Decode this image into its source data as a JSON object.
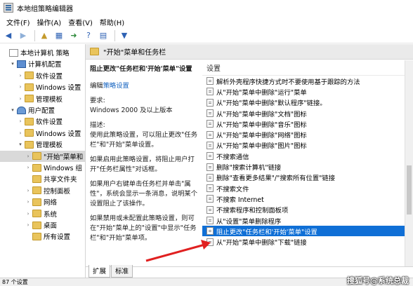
{
  "window": {
    "title": "本地组策略编辑器"
  },
  "menu": [
    "文件(F)",
    "操作(A)",
    "查看(V)",
    "帮助(H)"
  ],
  "tree": [
    {
      "label": "本地计算机 策略",
      "icon": "policy",
      "exp": "",
      "indent": 0
    },
    {
      "label": "计算机配置",
      "icon": "pc",
      "exp": "▾",
      "indent": 1
    },
    {
      "label": "软件设置",
      "icon": "folder",
      "exp": "›",
      "indent": 2
    },
    {
      "label": "Windows 设置",
      "icon": "folder",
      "exp": "›",
      "indent": 2
    },
    {
      "label": "管理模板",
      "icon": "folder",
      "exp": "›",
      "indent": 2
    },
    {
      "label": "用户配置",
      "icon": "user",
      "exp": "▾",
      "indent": 1
    },
    {
      "label": "软件设置",
      "icon": "folder",
      "exp": "›",
      "indent": 2
    },
    {
      "label": "Windows 设置",
      "icon": "folder",
      "exp": "›",
      "indent": 2
    },
    {
      "label": "管理模板",
      "icon": "folder",
      "exp": "▾",
      "indent": 2
    },
    {
      "label": "\"开始\"菜单和",
      "icon": "folder",
      "exp": "›",
      "indent": 3,
      "selected": true
    },
    {
      "label": "Windows 组",
      "icon": "folder",
      "exp": "›",
      "indent": 3
    },
    {
      "label": "共享文件夹",
      "icon": "folder",
      "exp": "",
      "indent": 3
    },
    {
      "label": "控制面板",
      "icon": "folder",
      "exp": "›",
      "indent": 3
    },
    {
      "label": "网络",
      "icon": "folder",
      "exp": "›",
      "indent": 3
    },
    {
      "label": "系统",
      "icon": "folder",
      "exp": "›",
      "indent": 3
    },
    {
      "label": "桌面",
      "icon": "folder",
      "exp": "›",
      "indent": 3
    },
    {
      "label": "所有设置",
      "icon": "folder",
      "exp": "",
      "indent": 3
    }
  ],
  "header": {
    "title": "\"开始\"菜单和任务栏"
  },
  "description": {
    "policy_title": "阻止更改\"任务栏和'开始'菜单\"设置",
    "edit_prefix": "编辑",
    "edit_link": "策略设置",
    "req_label": "要求:",
    "req_value": "Windows 2000 及以上版本",
    "desc_label": "描述:",
    "p1": "使用此策略设置，可以阻止更改\"任务栏\"和\"开始\"菜单设置。",
    "p2": "如果启用此策略设置，将阻止用户打开\"任务栏属性\"对话框。",
    "p3": "如果用户右键单击任务栏并单击\"属性\"，系统会显示一条消息，说明某个设置阻止了该操作。",
    "p4": "如果禁用或未配置此策略设置，则可在\"开始\"菜单上的\"设置\"中显示\"任务栏\"和\"开始\"菜单项。"
  },
  "settings": {
    "column_header": "设置",
    "items": [
      "解析外壳程序快捷方式时不要使用基于跟踪的方法",
      "从\"开始\"菜单中删除\"运行\"菜单",
      "从\"开始\"菜单中删除\"默认程序\"链接。",
      "从\"开始\"菜单中删除\"文档\"图标",
      "从\"开始\"菜单中删除\"音乐\"图标",
      "从\"开始\"菜单中删除\"网络\"图标",
      "从\"开始\"菜单中删除\"图片\"图标",
      "不搜索通信",
      "删除\"搜索计算机\"链接",
      "删除\"查看更多结果\"/\"搜索所有位置\"链接",
      "不搜索文件",
      "不搜索 Internet",
      "不搜索程序和控制面板项",
      "从\"设置\"菜单删除程序",
      "阻止更改\"任务栏和'开始'菜单\"设置",
      "从\"开始\"菜单中删除\"下载\"链接"
    ],
    "selected_index": 14
  },
  "tabs": [
    "扩展",
    "标准"
  ],
  "status": {
    "text": "87 个设置"
  },
  "watermark": "搜狐号@系统总裁",
  "colors": {
    "selection": "#0f6fd6",
    "arrow": "#e02020",
    "link": "#1463c0"
  },
  "icons": {
    "toolbar": [
      "back-arrow-icon",
      "forward-arrow-icon",
      "up-folder-icon",
      "show-tree-icon",
      "export-icon",
      "help-icon",
      "properties-icon",
      "filter-icon"
    ]
  }
}
